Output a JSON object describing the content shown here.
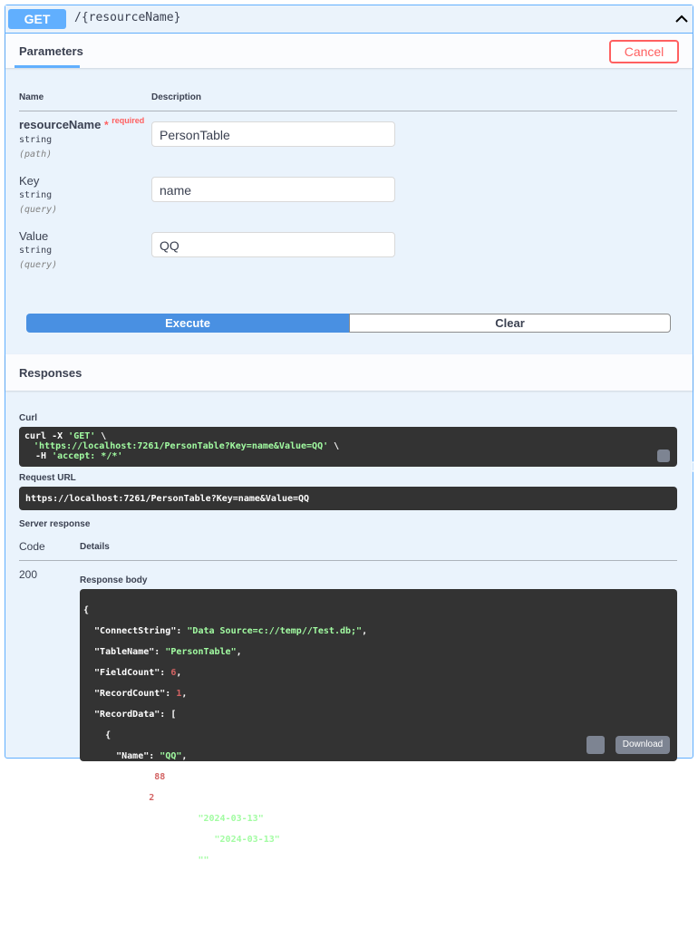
{
  "operation": {
    "method": "GET",
    "path": "/{resourceName}"
  },
  "parameters_tab": {
    "label": "Parameters",
    "cancel_label": "Cancel"
  },
  "param_table": {
    "name_header": "Name",
    "description_header": "Description"
  },
  "params": [
    {
      "name": "resourceName",
      "required_star": "*",
      "required_text": "required",
      "type": "string",
      "in": "(path)",
      "value": "PersonTable"
    },
    {
      "name": "Key",
      "type": "string",
      "in": "(query)",
      "value": "name"
    },
    {
      "name": "Value",
      "type": "string",
      "in": "(query)",
      "value": "QQ"
    }
  ],
  "actions": {
    "execute": "Execute",
    "clear": "Clear"
  },
  "responses": {
    "title": "Responses",
    "curl_label": "Curl",
    "curl_line1_prefix": "curl -X ",
    "curl_line1_method": "'GET'",
    "curl_line1_suffix": " \\",
    "curl_line2_url": "'https://localhost:7261/PersonTable?Key=name&Value=QQ'",
    "curl_line2_suffix": " \\",
    "curl_line3_prefix": "  -H ",
    "curl_line3_header": "'accept: */*'",
    "request_url_label": "Request URL",
    "request_url": "https://localhost:7261/PersonTable?Key=name&Value=QQ",
    "server_response_label": "Server response",
    "code_header": "Code",
    "details_header": "Details",
    "status_code": "200",
    "response_body_label": "Response body",
    "download_label": "Download",
    "body": {
      "ConnectString": "Data Source=c://temp//Test.db;",
      "TableName": "PersonTable",
      "FieldCount": "6",
      "RecordCount": "1",
      "record": {
        "Name": "QQ",
        "Age": "88",
        "Id": "2",
        "CreatedDate": "2024-03-13",
        "LastModifyDate": "2024-03-13",
        "CreatorName": ""
      }
    }
  },
  "colors": {
    "get_accent": "#61affe",
    "execute": "#4990e2",
    "cancel": "#ff6060",
    "code_bg": "#333333",
    "string": "#a2fca2",
    "number": "#d36363"
  }
}
